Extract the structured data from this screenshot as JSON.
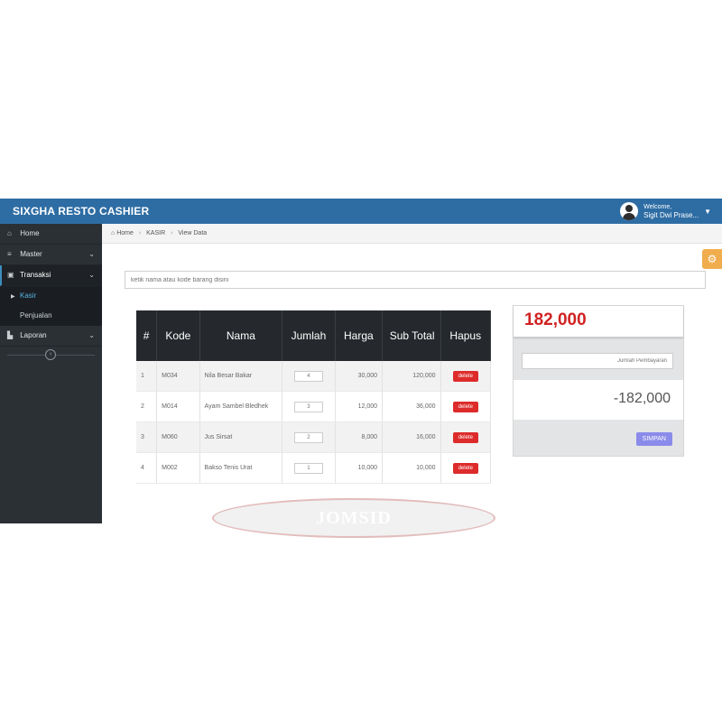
{
  "topbar": {
    "title": "SIXGHA RESTO CASHIER",
    "welcome": "Welcome,",
    "user_name": "Sigit Dwi Prase..."
  },
  "sidebar": {
    "items": [
      {
        "label": "Home",
        "icon": "home-icon"
      },
      {
        "label": "Master",
        "icon": "database-icon"
      },
      {
        "label": "Transaksi",
        "icon": "money-icon"
      },
      {
        "label": "Laporan",
        "icon": "bar-chart-icon"
      }
    ],
    "subitems": [
      {
        "label": "Kasir"
      },
      {
        "label": "Penjualan"
      }
    ],
    "toggle_glyph": "‹"
  },
  "breadcrumb": {
    "home": "Home",
    "kasir": "KASIR",
    "current": "View Data"
  },
  "search": {
    "placeholder": "ketik nama atau kode barang disini"
  },
  "cart": {
    "headers": [
      "#",
      "Kode",
      "Nama",
      "Jumlah",
      "Harga",
      "Sub Total",
      "Hapus"
    ],
    "rows": [
      {
        "no": "1",
        "kode": "M034",
        "nama": "Nila Besar Bakar",
        "jumlah": "4",
        "harga": "30,000",
        "subtotal": "120,000",
        "action": "delete"
      },
      {
        "no": "2",
        "kode": "M014",
        "nama": "Ayam Sambel Bledhek",
        "jumlah": "3",
        "harga": "12,000",
        "subtotal": "36,000",
        "action": "delete"
      },
      {
        "no": "3",
        "kode": "M060",
        "nama": "Jus Sirsat",
        "jumlah": "2",
        "harga": "8,000",
        "subtotal": "16,000",
        "action": "delete"
      },
      {
        "no": "4",
        "kode": "M002",
        "nama": "Bakso Tenis Urat",
        "jumlah": "1",
        "harga": "10,000",
        "subtotal": "10,000",
        "action": "delete"
      }
    ]
  },
  "payment": {
    "total": "182,000",
    "pay_placeholder": "Jumlah Pembayaran",
    "change": "-182,000",
    "save_label": "SIMPAN"
  },
  "watermark": "JOMSID",
  "colors": {
    "topbar": "#2e6da4",
    "sidebar": "#2b3035",
    "total_text": "#d02222",
    "delete_button": "#dd2b2b",
    "save_button": "#8a8bea",
    "settings_button": "#f0ad4e"
  }
}
